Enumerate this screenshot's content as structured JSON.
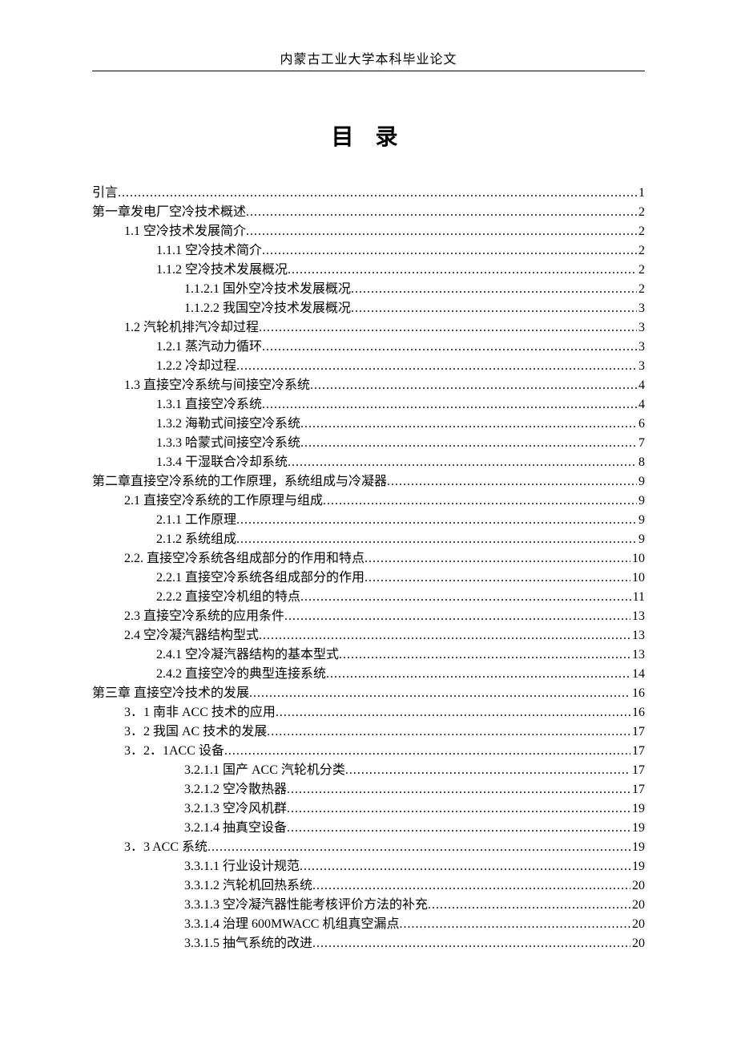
{
  "header": "内蒙古工业大学本科毕业论文",
  "title": "目 录",
  "toc": [
    {
      "level": 0,
      "label": "引言",
      "page": "1"
    },
    {
      "level": 0,
      "label": "第一章发电厂空冷技术概述",
      "page": "2"
    },
    {
      "level": 1,
      "label": "1.1 空冷技术发展简介",
      "page": "2"
    },
    {
      "level": 2,
      "label": "1.1.1 空冷技术简介 ",
      "page": "2"
    },
    {
      "level": 2,
      "label": "1.1.2 空冷技术发展概况 ",
      "page": "2"
    },
    {
      "level": 3,
      "label": "1.1.2.1 国外空冷技术发展概况",
      "page": "2"
    },
    {
      "level": 3,
      "label": "1.1.2.2 我国空冷技术发展概况",
      "page": "3"
    },
    {
      "level": 1,
      "label": "1.2 汽轮机排汽冷却过程",
      "page": "3"
    },
    {
      "level": 2,
      "label": "1.2.1 蒸汽动力循环 ",
      "page": "3"
    },
    {
      "level": 2,
      "label": "1.2.2 冷却过程 ",
      "page": "3"
    },
    {
      "level": 1,
      "label": "1.3 直接空冷系统与间接空冷系统",
      "page": "4"
    },
    {
      "level": 2,
      "label": "1.3.1 直接空冷系统 ",
      "page": "4"
    },
    {
      "level": 2,
      "label": "1.3.2 海勒式间接空冷系统 ",
      "page": "6"
    },
    {
      "level": 2,
      "label": "1.3.3 哈蒙式间接空冷系统 ",
      "page": "7"
    },
    {
      "level": 2,
      "label": "1.3.4 干湿联合冷却系统 ",
      "page": "8"
    },
    {
      "level": 0,
      "label": "第二章直接空冷系统的工作原理，系统组成与冷凝器",
      "page": "9"
    },
    {
      "level": 1,
      "label": "2.1 直接空冷系统的工作原理与组成",
      "page": "9"
    },
    {
      "level": 2,
      "label": "2.1.1 工作原理 ",
      "page": "9"
    },
    {
      "level": 2,
      "label": "2.1.2 系统组成 ",
      "page": "9"
    },
    {
      "level": 1,
      "label": "2.2. 直接空冷系统各组成部分的作用和特点 ",
      "page": " 10"
    },
    {
      "level": 2,
      "label": "2.2.1 直接空冷系统各组成部分的作用 ",
      "page": " 10"
    },
    {
      "level": 2,
      "label": "2.2.2 直接空冷机组的特点 ",
      "page": "11"
    },
    {
      "level": 1,
      "label": "2.3 直接空冷系统的应用条件",
      "page": " 13"
    },
    {
      "level": 1,
      "label": "2.4 空冷凝汽器结构型式",
      "page": " 13"
    },
    {
      "level": 2,
      "label": "2.4.1 空冷凝汽器结构的基本型式 ",
      "page": " 13"
    },
    {
      "level": 2,
      "label": "2.4.2 直接空冷的典型连接系统 ",
      "page": " 14"
    },
    {
      "level": 0,
      "label": "第三章  直接空冷技术的发展",
      "page": " 16"
    },
    {
      "level": 1,
      "label": "3．1 南非 ACC 技术的应用",
      "page": " 16"
    },
    {
      "level": 1,
      "label": "3．2 我国 AC 技术的发展",
      "page": " 17"
    },
    {
      "level": 1,
      "label": "3．2．1ACC 设备",
      "page": " 17"
    },
    {
      "level": 3,
      "label": "3.2.1.1 国产 ACC 汽轮机分类",
      "page": " 17"
    },
    {
      "level": 3,
      "label": "3.2.1.2 空冷散热器",
      "page": " 17"
    },
    {
      "level": 3,
      "label": "3.2.1.3 空冷风机群",
      "page": " 19"
    },
    {
      "level": 3,
      "label": "3.2.1.4 抽真空设备",
      "page": " 19"
    },
    {
      "level": 1,
      "label": "3．3 ACC 系统",
      "page": " 19"
    },
    {
      "level": 3,
      "label": "3.3.1.1 行业设计规范",
      "page": " 19"
    },
    {
      "level": 3,
      "label": "3.3.1.2 汽轮机回热系统",
      "page": " 20"
    },
    {
      "level": 3,
      "label": "3.3.1.3 空冷凝汽器性能考核评价方法的补充",
      "page": " 20"
    },
    {
      "level": 3,
      "label": "3.3.1.4 治理 600MWACC 机组真空漏点",
      "page": " 20"
    },
    {
      "level": 3,
      "label": "3.3.1.5 抽气系统的改进",
      "page": " 20"
    }
  ]
}
